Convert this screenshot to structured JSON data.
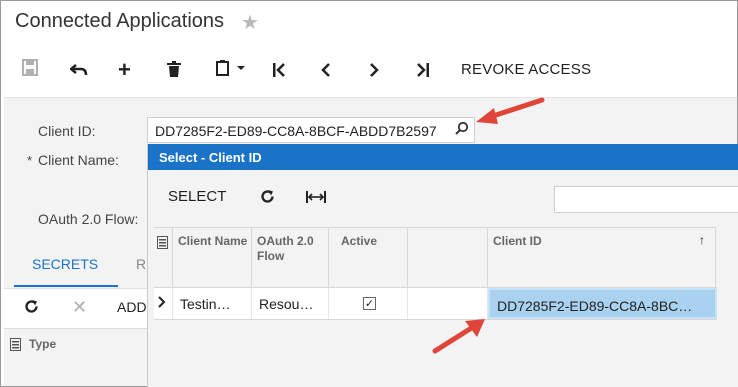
{
  "page": {
    "title": "Connected Applications"
  },
  "toolbar": {
    "revoke_label": "REVOKE ACCESS"
  },
  "form": {
    "client_id_label": "Client ID:",
    "client_id_value": "DD7285F2-ED89-CC8A-8BCF-ABDD7B2597",
    "client_name_label": "Client Name:",
    "required_mark": "*",
    "oauth_flow_label": "OAuth 2.0 Flow:"
  },
  "tabs": {
    "secrets": "SECRETS",
    "next_partial": "R"
  },
  "sub_toolbar": {
    "add_partial": "ADD"
  },
  "grid_left": {
    "type_header": "Type"
  },
  "popup": {
    "title": "Select - Client ID",
    "select_label": "SELECT",
    "columns": [
      "Client Name",
      "OAuth 2.0 Flow",
      "Active",
      "",
      "Client ID"
    ],
    "rows": [
      {
        "client_name": "Testin…",
        "oauth_flow": "Resou…",
        "active": true,
        "client_id": "DD7285F2-ED89-CC8A-8BC…"
      }
    ]
  },
  "colors": {
    "accent": "#1a73c7",
    "selection": "#a9d2f0",
    "annotation_arrow": "#e0453a"
  },
  "icons": [
    "save-icon",
    "undo-icon",
    "add-icon",
    "delete-icon",
    "paste-icon",
    "first-icon",
    "prev-icon",
    "next-icon",
    "last-icon",
    "star-icon",
    "search-icon",
    "refresh-icon",
    "fit-columns-icon",
    "row-arrow-icon",
    "sort-up-icon",
    "grid-settings-icon"
  ]
}
